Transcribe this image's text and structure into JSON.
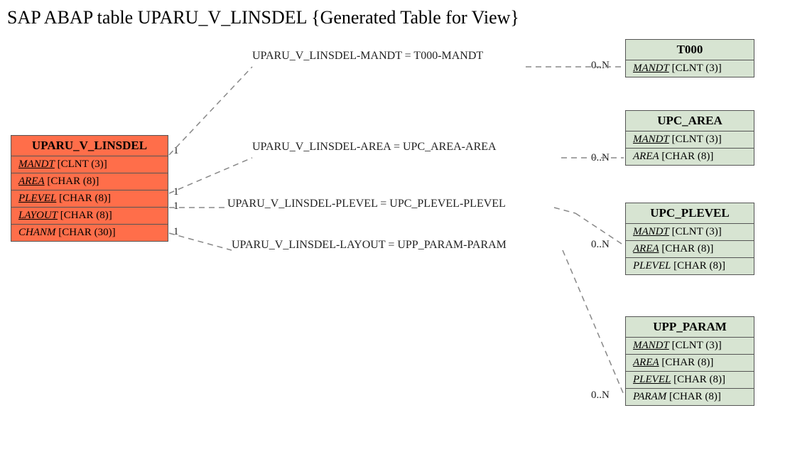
{
  "title": "SAP ABAP table UPARU_V_LINSDEL {Generated Table for View}",
  "main_entity": {
    "name": "UPARU_V_LINSDEL",
    "fields": [
      {
        "name": "MANDT",
        "type": "[CLNT (3)]",
        "underline": true
      },
      {
        "name": "AREA",
        "type": "[CHAR (8)]",
        "underline": true
      },
      {
        "name": "PLEVEL",
        "type": "[CHAR (8)]",
        "underline": true
      },
      {
        "name": "LAYOUT",
        "type": "[CHAR (8)]",
        "underline": true
      },
      {
        "name": "CHANM",
        "type": "[CHAR (30)]",
        "underline": false
      }
    ]
  },
  "related_entities": [
    {
      "name": "T000",
      "fields": [
        {
          "name": "MANDT",
          "type": "[CLNT (3)]",
          "underline": true
        }
      ]
    },
    {
      "name": "UPC_AREA",
      "fields": [
        {
          "name": "MANDT",
          "type": "[CLNT (3)]",
          "underline": true
        },
        {
          "name": "AREA",
          "type": "[CHAR (8)]",
          "underline": false
        }
      ]
    },
    {
      "name": "UPC_PLEVEL",
      "fields": [
        {
          "name": "MANDT",
          "type": "[CLNT (3)]",
          "underline": true
        },
        {
          "name": "AREA",
          "type": "[CHAR (8)]",
          "underline": true
        },
        {
          "name": "PLEVEL",
          "type": "[CHAR (8)]",
          "underline": false
        }
      ]
    },
    {
      "name": "UPP_PARAM",
      "fields": [
        {
          "name": "MANDT",
          "type": "[CLNT (3)]",
          "underline": true
        },
        {
          "name": "AREA",
          "type": "[CHAR (8)]",
          "underline": true
        },
        {
          "name": "PLEVEL",
          "type": "[CHAR (8)]",
          "underline": true
        },
        {
          "name": "PARAM",
          "type": "[CHAR (8)]",
          "underline": false
        }
      ]
    }
  ],
  "relations": [
    {
      "label": "UPARU_V_LINSDEL-MANDT = T000-MANDT",
      "left_card": "1",
      "right_card": "0..N"
    },
    {
      "label": "UPARU_V_LINSDEL-AREA = UPC_AREA-AREA",
      "left_card": "1",
      "right_card": "0..N"
    },
    {
      "label": "UPARU_V_LINSDEL-PLEVEL = UPC_PLEVEL-PLEVEL",
      "left_card": "1",
      "right_card": "0..N"
    },
    {
      "label": "UPARU_V_LINSDEL-LAYOUT = UPP_PARAM-PARAM",
      "left_card": "1",
      "right_card": "0..N"
    }
  ]
}
